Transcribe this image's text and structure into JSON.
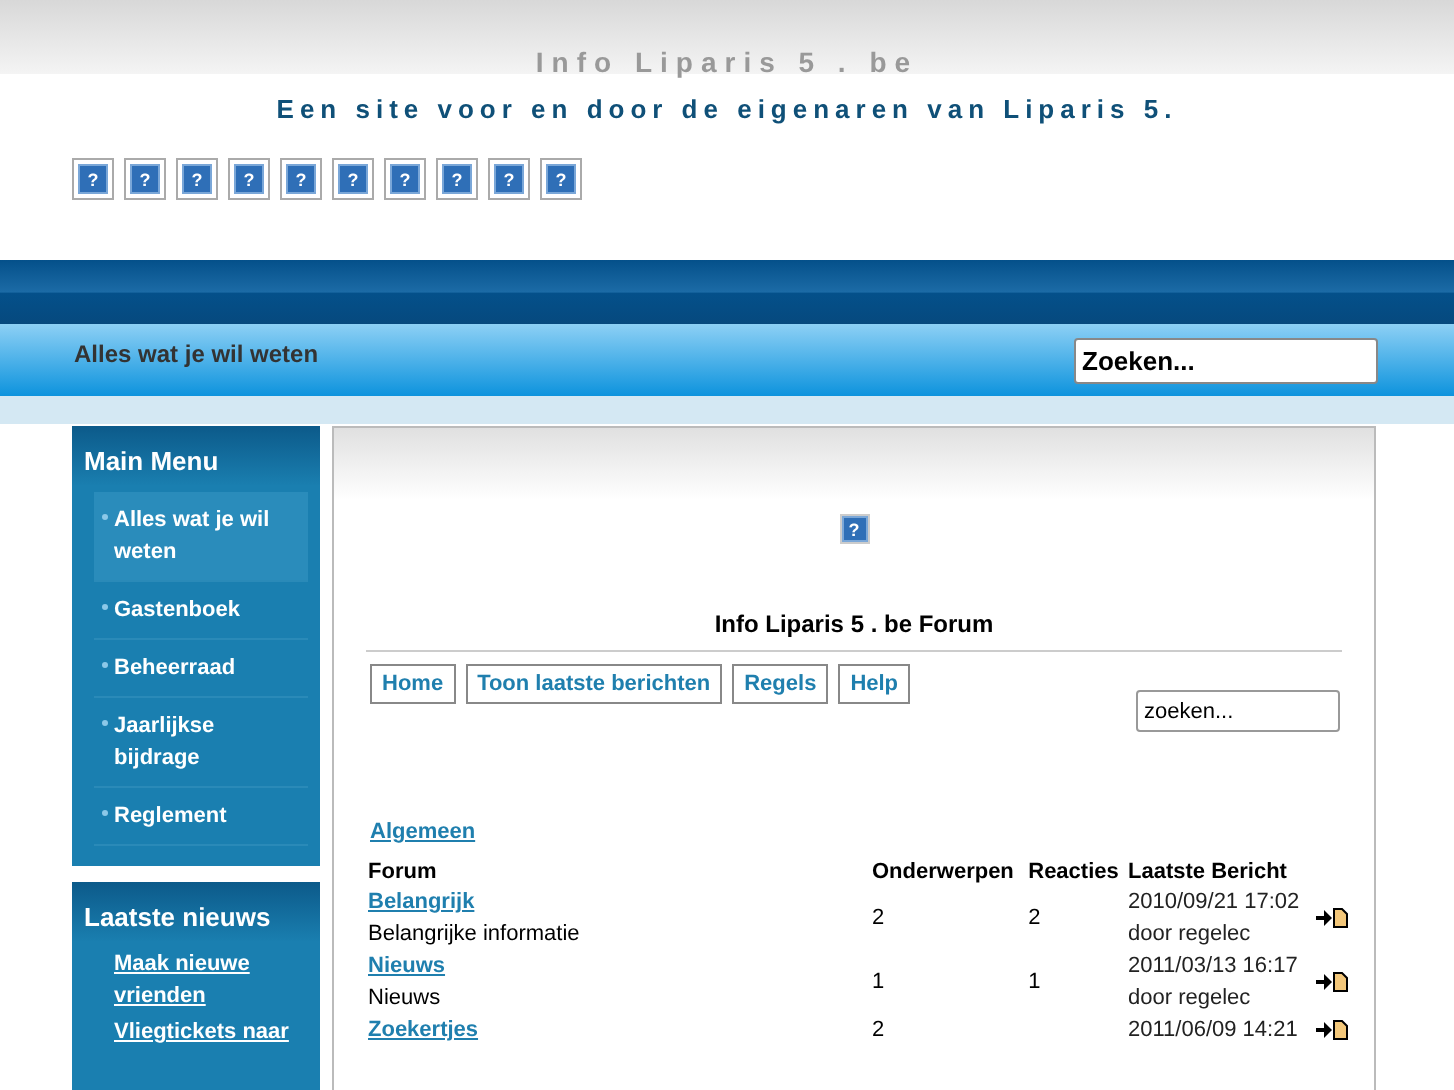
{
  "header": {
    "title": "Info Liparis 5 . be",
    "subtitle": "Een site voor en door de eigenaren van Liparis 5.",
    "icons": [
      "?",
      "?",
      "?",
      "?",
      "?",
      "?",
      "?",
      "?",
      "?",
      "?"
    ]
  },
  "bar": {
    "label": "Alles wat je wil weten",
    "search": {
      "value": "Zoeken..."
    }
  },
  "main_menu": {
    "title": "Main Menu",
    "items": [
      {
        "label": "Alles wat je wil weten",
        "selected": true
      },
      {
        "label": "Gastenboek",
        "selected": false
      },
      {
        "label": "Beheerraad",
        "selected": false
      },
      {
        "label": "Jaarlijkse bijdrage",
        "selected": false
      },
      {
        "label": "Reglement",
        "selected": false
      }
    ]
  },
  "latest_news": {
    "title": "Laatste nieuws",
    "items": [
      "Maak nieuwe vrienden",
      "Vliegtickets naar"
    ]
  },
  "forum": {
    "image": "?",
    "title": "Info Liparis 5 . be Forum",
    "nav": [
      "Home",
      "Toon laatste berichten",
      "Regels",
      "Help"
    ],
    "search": {
      "placeholder": "zoeken..."
    },
    "category": "Algemeen",
    "columns": [
      "Forum",
      "Onderwerpen",
      "Reacties",
      "Laatste Bericht"
    ],
    "rows": [
      {
        "name": "Belangrijk",
        "description": "Belangrijke informatie",
        "topics": "2",
        "replies": "2",
        "last_date": "2010/09/21 17:02",
        "last_by": "door regelec"
      },
      {
        "name": "Nieuws",
        "description": "Nieuws",
        "topics": "1",
        "replies": "1",
        "last_date": "2011/03/13 16:17",
        "last_by": "door regelec"
      },
      {
        "name": "Zoekertjes",
        "topics": "2",
        "last_date": "2011/06/09 14:21"
      }
    ]
  }
}
